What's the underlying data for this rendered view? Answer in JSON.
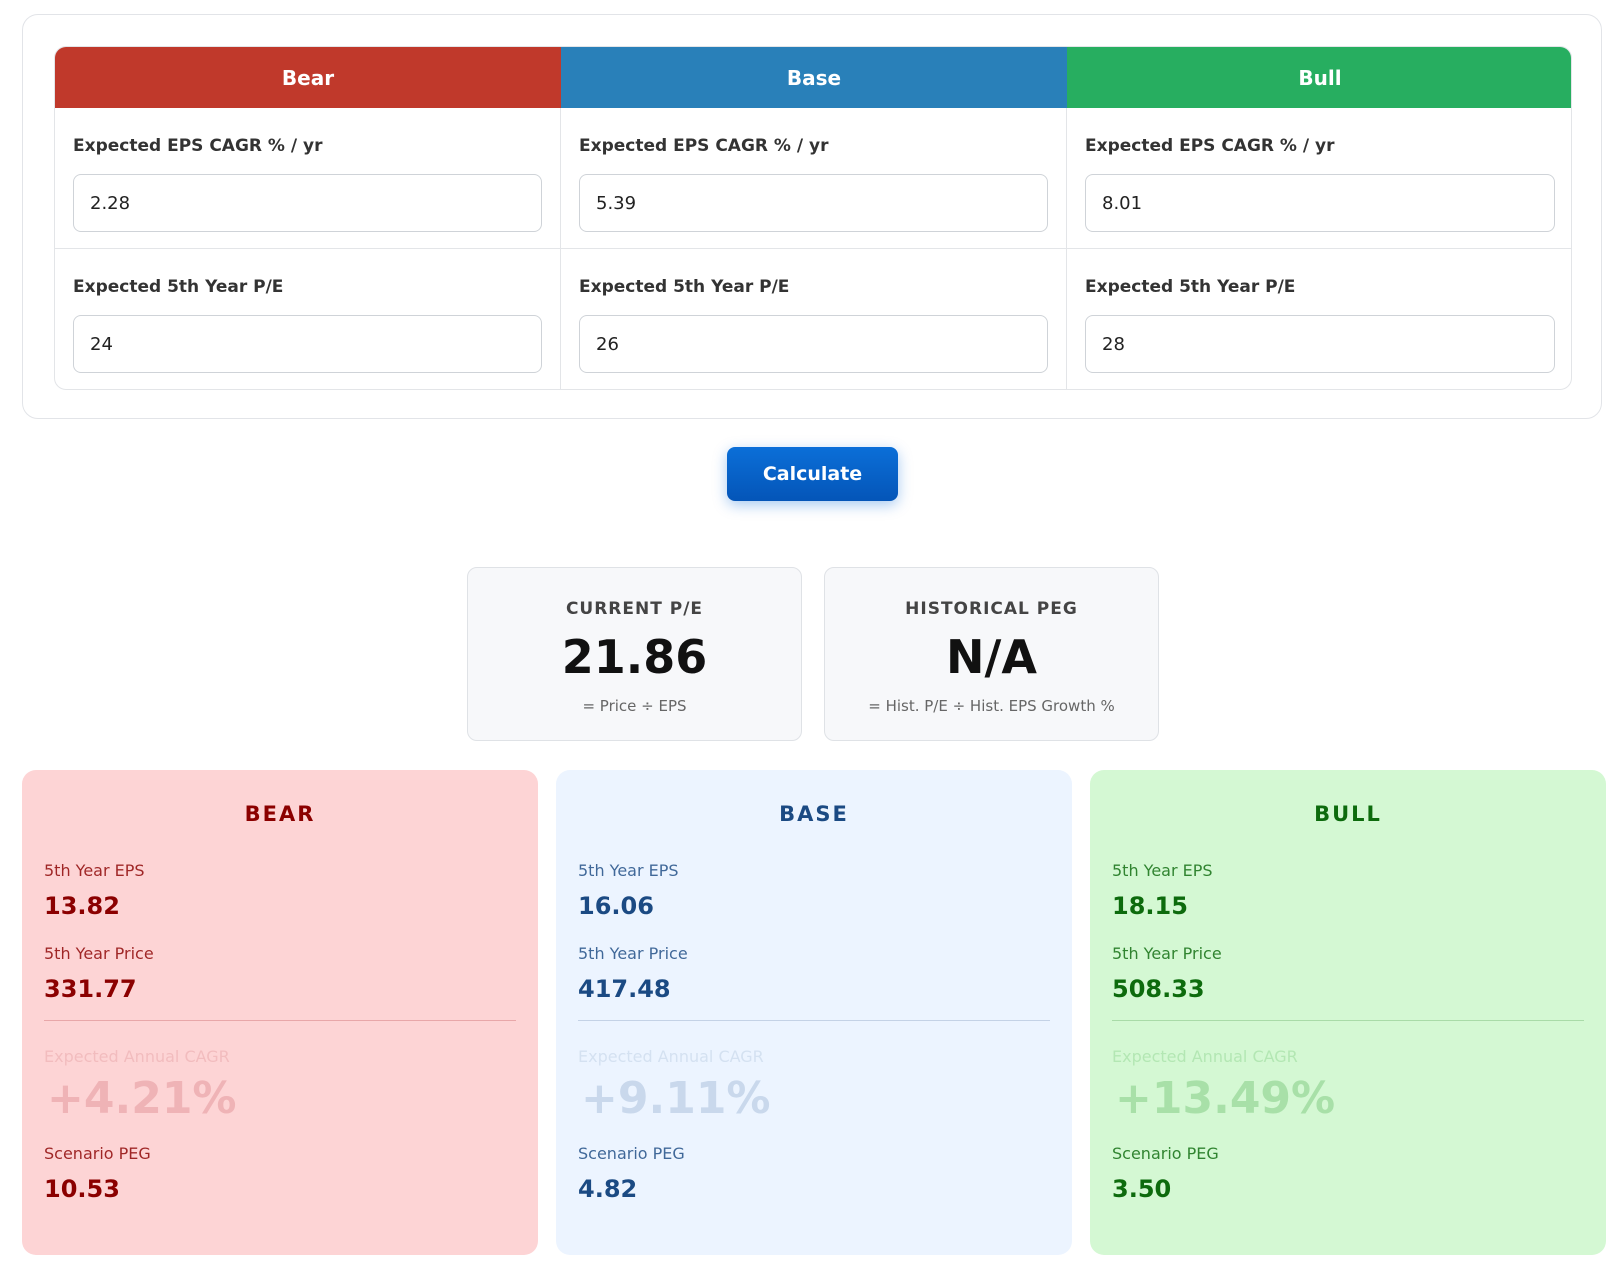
{
  "scenarios": {
    "bear": {
      "header": "Bear",
      "eps_cagr_label": "Expected EPS CAGR % / yr",
      "eps_cagr_value": "2.28",
      "pe_label": "Expected 5th Year P/E",
      "pe_value": "24"
    },
    "base": {
      "header": "Base",
      "eps_cagr_label": "Expected EPS CAGR % / yr",
      "eps_cagr_value": "5.39",
      "pe_label": "Expected 5th Year P/E",
      "pe_value": "26"
    },
    "bull": {
      "header": "Bull",
      "eps_cagr_label": "Expected EPS CAGR % / yr",
      "eps_cagr_value": "8.01",
      "pe_label": "Expected 5th Year P/E",
      "pe_value": "28"
    }
  },
  "calculate_label": "Calculate",
  "metrics": {
    "current_pe": {
      "label": "CURRENT P/E",
      "value": "21.86",
      "formula": "= Price ÷ EPS"
    },
    "historical_peg": {
      "label": "HISTORICAL PEG",
      "value": "N/A",
      "formula": "= Hist. P/E ÷ Hist. EPS Growth %"
    }
  },
  "results": {
    "bear": {
      "title": "BEAR",
      "eps_label": "5th Year EPS",
      "eps_value": "13.82",
      "price_label": "5th Year Price",
      "price_value": "331.77",
      "cagr_label": "Expected Annual CAGR",
      "cagr_value": "+4.21%",
      "peg_label": "Scenario PEG",
      "peg_value": "10.53"
    },
    "base": {
      "title": "BASE",
      "eps_label": "5th Year EPS",
      "eps_value": "16.06",
      "price_label": "5th Year Price",
      "price_value": "417.48",
      "cagr_label": "Expected Annual CAGR",
      "cagr_value": "+9.11%",
      "peg_label": "Scenario PEG",
      "peg_value": "4.82"
    },
    "bull": {
      "title": "BULL",
      "eps_label": "5th Year EPS",
      "eps_value": "18.15",
      "price_label": "5th Year Price",
      "price_value": "508.33",
      "cagr_label": "Expected Annual CAGR",
      "cagr_value": "+13.49%",
      "peg_label": "Scenario PEG",
      "peg_value": "3.50"
    }
  },
  "colors": {
    "bear_header": "#c0392b",
    "base_header": "#2980b9",
    "bull_header": "#27ae60",
    "button": "#0455b8",
    "bear_card": "#fdd4d5",
    "base_card": "#ecf4ff",
    "bull_card": "#d4f8d3"
  }
}
